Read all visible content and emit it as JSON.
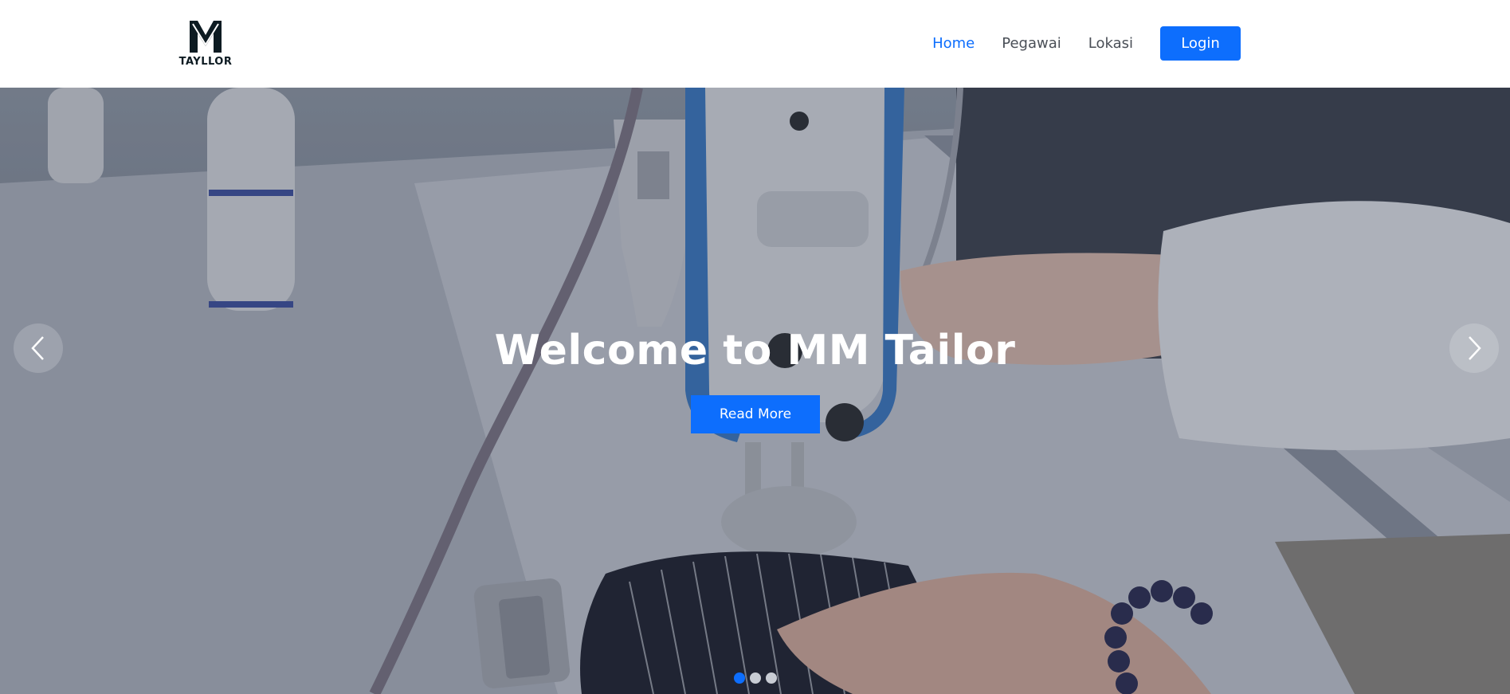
{
  "brand": {
    "logo_text": "TAYLLOR"
  },
  "nav": {
    "items": [
      {
        "label": "Home",
        "active": true
      },
      {
        "label": "Pegawai",
        "active": false
      },
      {
        "label": "Lokasi",
        "active": false
      }
    ],
    "login_label": "Login"
  },
  "hero": {
    "title": "Welcome to MM Tailor",
    "button_label": "Read More",
    "slides": {
      "count": 3,
      "active_index": 0
    },
    "prev_icon": "chevron-left-icon",
    "next_icon": "chevron-right-icon"
  },
  "colors": {
    "accent": "#0d6efd",
    "nav_text": "#4a4f57"
  }
}
